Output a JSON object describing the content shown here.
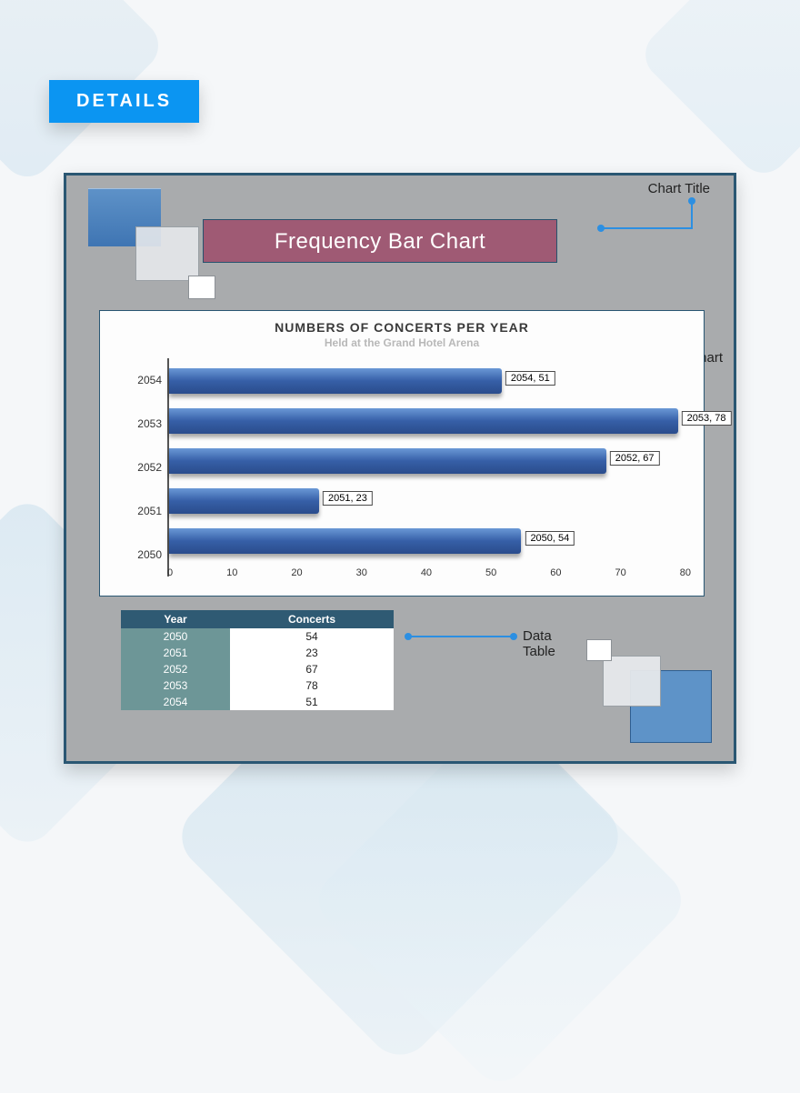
{
  "header": {
    "tab_label": "DETAILS"
  },
  "annotations": {
    "chart_title_label": "Chart Title",
    "chart_label": "Chart",
    "data_table_label": "Data Table"
  },
  "main_title": "Frequency Bar Chart",
  "chart_heading": "NUMBERS OF CONCERTS PER YEAR",
  "chart_subheading": "Held at the Grand Hotel Arena",
  "table_headers": {
    "year": "Year",
    "concerts": "Concerts"
  },
  "chart_data": {
    "type": "bar",
    "orientation": "horizontal",
    "title": "NUMBERS OF CONCERTS PER YEAR",
    "subtitle": "Held at the Grand Hotel Arena",
    "xlabel": "",
    "ylabel": "",
    "xlim": [
      0,
      80
    ],
    "x_ticks": [
      0,
      10,
      20,
      30,
      40,
      50,
      60,
      70,
      80
    ],
    "categories": [
      "2054",
      "2053",
      "2052",
      "2051",
      "2050"
    ],
    "values": [
      51,
      78,
      67,
      23,
      54
    ],
    "data_labels": [
      "2054, 51",
      "2053, 78",
      "2052, 67",
      "2051, 23",
      "2050, 54"
    ],
    "table": [
      {
        "year": "2050",
        "concerts": 54
      },
      {
        "year": "2051",
        "concerts": 23
      },
      {
        "year": "2052",
        "concerts": 67
      },
      {
        "year": "2053",
        "concerts": 78
      },
      {
        "year": "2054",
        "concerts": 51
      }
    ]
  }
}
